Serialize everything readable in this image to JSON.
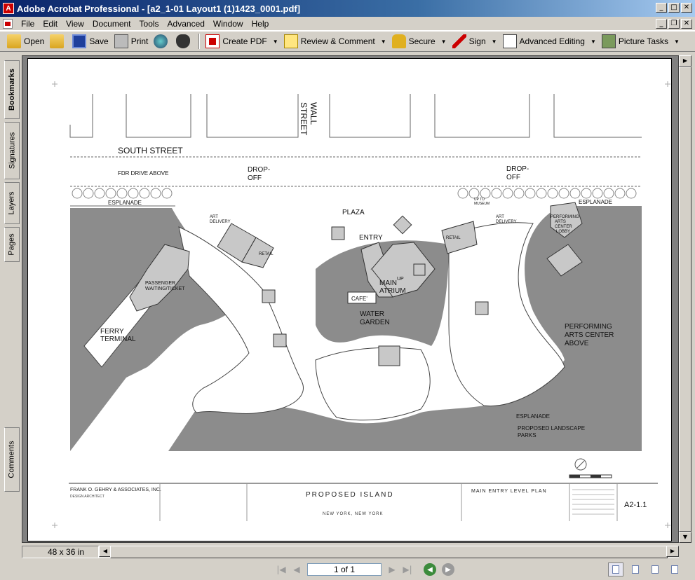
{
  "window": {
    "title": "Adobe Acrobat Professional - [a2_1-01 Layout1 (1)1423_0001.pdf]",
    "app_icon_label": "A"
  },
  "menu": [
    {
      "label": "File"
    },
    {
      "label": "Edit"
    },
    {
      "label": "View"
    },
    {
      "label": "Document"
    },
    {
      "label": "Tools"
    },
    {
      "label": "Advanced"
    },
    {
      "label": "Window"
    },
    {
      "label": "Help"
    }
  ],
  "toolbar": {
    "open": "Open",
    "save": "Save",
    "print": "Print",
    "create_pdf": "Create PDF",
    "review_comment": "Review & Comment",
    "secure": "Secure",
    "sign": "Sign",
    "advanced_editing": "Advanced Editing",
    "picture_tasks": "Picture Tasks"
  },
  "nav_tabs": {
    "bookmarks": "Bookmarks",
    "signatures": "Signatures",
    "layers": "Layers",
    "pages": "Pages",
    "comments": "Comments"
  },
  "drawing": {
    "labels": {
      "south_street": "SOUTH STREET",
      "wall": "WALL",
      "street": "STREET",
      "fdr": "FDR DRIVE ABOVE",
      "drop_off_1a": "DROP-",
      "drop_off_1b": "OFF",
      "drop_off_2a": "DROP-",
      "drop_off_2b": "OFF",
      "esplanade_left": "ESPLANADE",
      "esplanade_right": "ESPLANADE",
      "esplanade_bottom": "ESPLANADE",
      "plaza": "PLAZA",
      "entry": "ENTRY",
      "main": "MAIN",
      "atrium": "ATRIUM",
      "up": "UP",
      "cafe": "CAFE'",
      "water": "WATER",
      "garden": "GARDEN",
      "art_delivery_left_a": "ART",
      "art_delivery_left_b": "DELIVERY",
      "retail_left": "RETAIL",
      "art_delivery_right_a": "ART",
      "art_delivery_right_b": "DELIVERY",
      "retail_right": "RETAIL",
      "up_to_a": "UP TO",
      "up_to_b": "MUSEUM",
      "pac_lobby_a": "PERFORMING",
      "pac_lobby_b": "ARTS",
      "pac_lobby_c": "CENTER",
      "pac_lobby_d": "LOBBY",
      "passenger_a": "PASSENGER",
      "passenger_b": "WAITING/TICKET",
      "ferry_a": "FERRY",
      "ferry_b": "TERMINAL",
      "pac_above_a": "PERFORMING",
      "pac_above_b": "ARTS CENTER",
      "pac_above_c": "ABOVE",
      "landscape_a": "PROPOSED LANDSCAPE",
      "landscape_b": "PARKS"
    },
    "titleblock": {
      "firm": "FRANK O. GEHRY & ASSOCIATES, INC.",
      "role": "DESIGN ARCHITECT",
      "project": "PROPOSED ISLAND",
      "location": "NEW YORK, NEW YORK",
      "sheet_title": "MAIN ENTRY LEVEL PLAN",
      "sheet_number": "A2-1.1"
    }
  },
  "footer": {
    "page_size": "48 x 36 in",
    "page_indicator": "1 of 1"
  }
}
